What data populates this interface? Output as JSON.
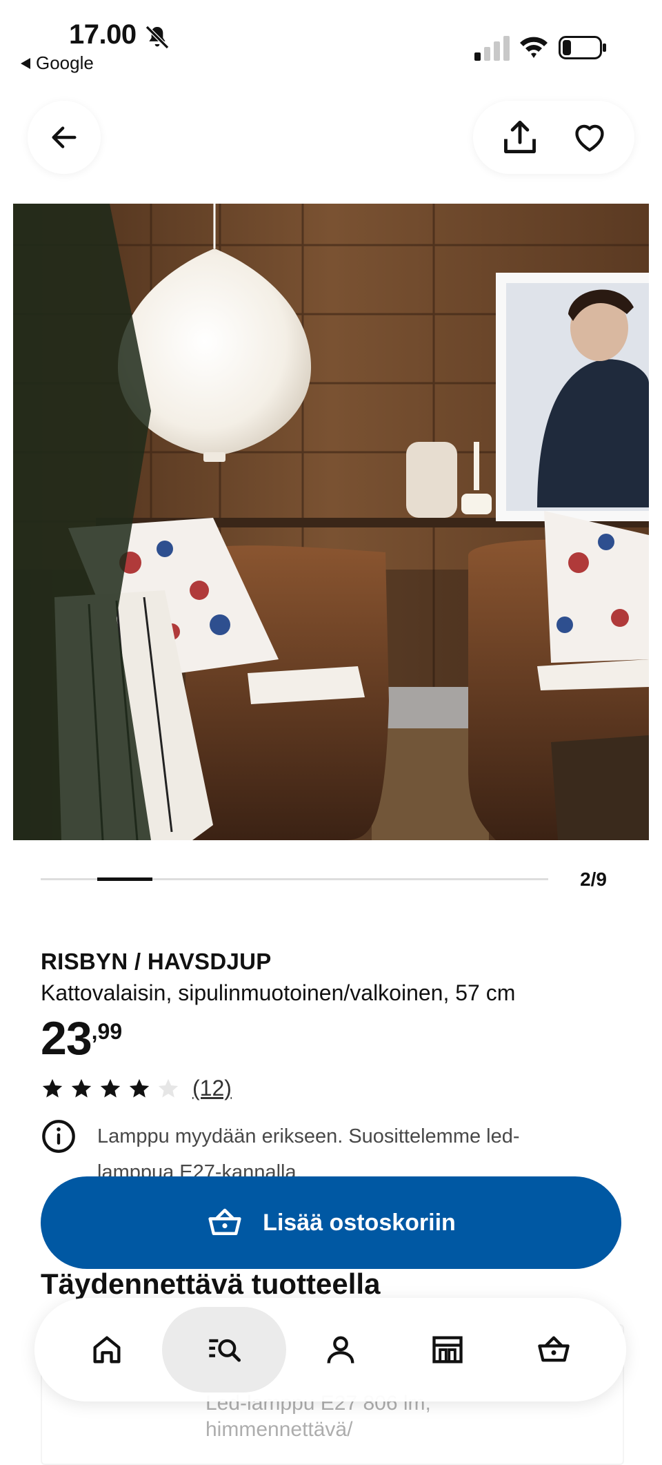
{
  "status_bar": {
    "time": "17.00",
    "back_app": "Google",
    "icons": [
      "bell-slash-icon",
      "signal-icon",
      "wifi-icon",
      "battery-icon"
    ]
  },
  "top_bar": {
    "icons": [
      "arrow-left-icon",
      "share-icon",
      "heart-icon"
    ]
  },
  "carousel": {
    "counter": "2/9",
    "position": 2,
    "total": 9
  },
  "product": {
    "name": "RISBYN / HAVSDJUP",
    "description": "Kattovalaisin, sipulinmuotoinen/valkoinen, 57 cm",
    "price_main": "23",
    "price_decimals": ",99",
    "rating": 4,
    "rating_max": 5,
    "review_count": "(12)",
    "info_text": "Lamppu myydään erikseen. Suosittelemme led-lamppua E27-kannalla."
  },
  "cart_button": {
    "label": "Lisää ostoskoriin",
    "icon": "basket-icon"
  },
  "section": {
    "title": "Täydennettävä tuotteella"
  },
  "recommendation": {
    "title": "Led-lamppu E27 806 lm,",
    "subtitle": "himmennettävä/"
  },
  "bottom_nav": {
    "items": [
      {
        "icon": "home-icon",
        "active": false
      },
      {
        "icon": "search-list-icon",
        "active": true
      },
      {
        "icon": "profile-icon",
        "active": false
      },
      {
        "icon": "store-icon",
        "active": false
      },
      {
        "icon": "basket-icon",
        "active": false
      }
    ]
  },
  "colors": {
    "accent": "#0058a3",
    "text": "#111111",
    "muted": "#484848"
  }
}
